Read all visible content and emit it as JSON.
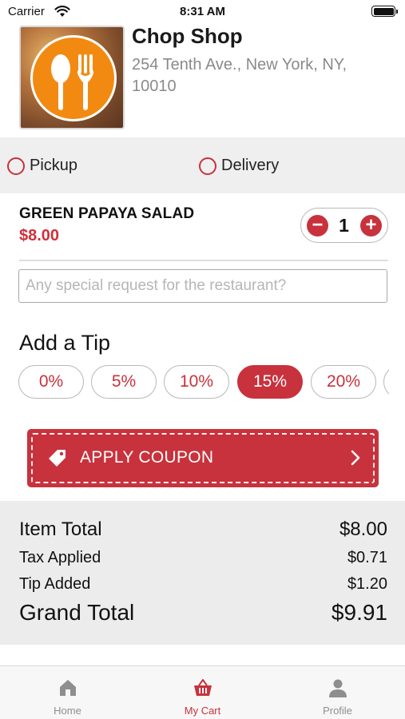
{
  "status_bar": {
    "carrier": "Carrier",
    "time": "8:31 AM"
  },
  "restaurant": {
    "name": "Chop Shop",
    "address": "254 Tenth Ave., New York, NY, 10010"
  },
  "order_type": {
    "options": [
      {
        "label": "Pickup",
        "selected": false
      },
      {
        "label": "Delivery",
        "selected": false
      }
    ]
  },
  "item": {
    "name": "GREEN PAPAYA SALAD",
    "price": "$8.00",
    "quantity": "1",
    "minus": "−",
    "plus": "+"
  },
  "special_request": {
    "value": "",
    "placeholder": "Any special request for the restaurant?"
  },
  "tip": {
    "heading": "Add a Tip",
    "options": [
      "0%",
      "5%",
      "10%",
      "15%",
      "20%",
      ""
    ],
    "selected": "15%"
  },
  "coupon": {
    "label": "APPLY COUPON",
    "icon": "tag-icon"
  },
  "totals": {
    "item_total_label": "Item Total",
    "item_total_value": "$8.00",
    "tax_label": "Tax Applied",
    "tax_value": "$0.71",
    "tip_label": "Tip Added",
    "tip_value": "$1.20",
    "grand_label": "Grand Total",
    "grand_value": "$9.91"
  },
  "tab_bar": {
    "tabs": [
      {
        "label": "Home",
        "icon": "home-icon",
        "active": false
      },
      {
        "label": "My Cart",
        "icon": "basket-icon",
        "active": true
      },
      {
        "label": "Profile",
        "icon": "person-icon",
        "active": false
      }
    ]
  },
  "colors": {
    "accent": "#c8323c",
    "logo_orange": "#f28a12",
    "panel_gray": "#efefef"
  }
}
